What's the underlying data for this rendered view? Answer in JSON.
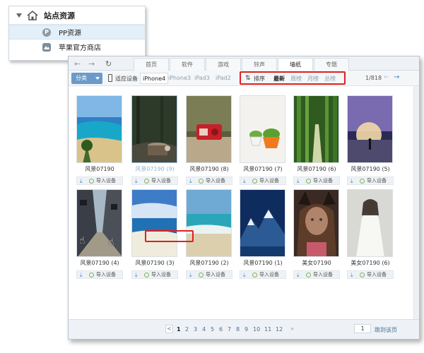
{
  "sidebar": {
    "title": "站点资源",
    "items": [
      {
        "label": "PP资源",
        "icon": "pp-logo-icon",
        "selected": true
      },
      {
        "label": "苹果官方商店",
        "icon": "app-store-icon",
        "selected": false
      }
    ]
  },
  "tabs": [
    {
      "label": "首页"
    },
    {
      "label": "软件"
    },
    {
      "label": "游戏"
    },
    {
      "label": "铃声"
    },
    {
      "label": "墙纸"
    },
    {
      "label": "专题"
    }
  ],
  "active_tab": "墙纸",
  "toolbar": {
    "category_label": "分类",
    "device_label": "适应设备",
    "devices": [
      "iPhone4",
      "iPhone3",
      "iPad3",
      "iPad2"
    ],
    "active_device": "iPhone4",
    "sort_label": "排序",
    "ranks": [
      "最新",
      "周榜",
      "月榜",
      "总榜"
    ],
    "active_rank": "最新",
    "page_info": "1/818"
  },
  "import_label": "导入设备",
  "wallpapers": [
    {
      "caption": "风景07190",
      "theme": "beach-aerial",
      "selected": false
    },
    {
      "caption": "风景07190 (9)",
      "theme": "forest-stump",
      "selected": true
    },
    {
      "caption": "风景07190 (8)",
      "theme": "red-radio",
      "selected": false
    },
    {
      "caption": "风景07190 (7)",
      "theme": "potted-plants",
      "selected": false
    },
    {
      "caption": "风景07190 (6)",
      "theme": "bamboo-path",
      "selected": false
    },
    {
      "caption": "风景07190 (5)",
      "theme": "sunset-silhouette",
      "selected": false
    },
    {
      "caption": "风景07190 (4)",
      "theme": "alley-street",
      "selected": false
    },
    {
      "caption": "风景07190 (3)",
      "theme": "sea-shore",
      "selected": false
    },
    {
      "caption": "风景07190 (2)",
      "theme": "turquoise-beach",
      "selected": false
    },
    {
      "caption": "风景07190 (1)",
      "theme": "mountain-night",
      "selected": false
    },
    {
      "caption": "美女07190",
      "theme": "girl-cat-ears",
      "selected": false
    },
    {
      "caption": "美女07190 (6)",
      "theme": "bride-portrait",
      "selected": false
    }
  ],
  "pagination": {
    "prev": "<",
    "pages": [
      "1",
      "2",
      "3",
      "4",
      "5",
      "6",
      "7",
      "8",
      "9",
      "10",
      "11",
      "12"
    ],
    "current": "1",
    "next": "»",
    "jump_value": "1",
    "jump_label": "跳到该页"
  },
  "colors": {
    "accent": "#3a88d1",
    "highlight": "#e02020",
    "category_button": "#6b9ac8"
  }
}
